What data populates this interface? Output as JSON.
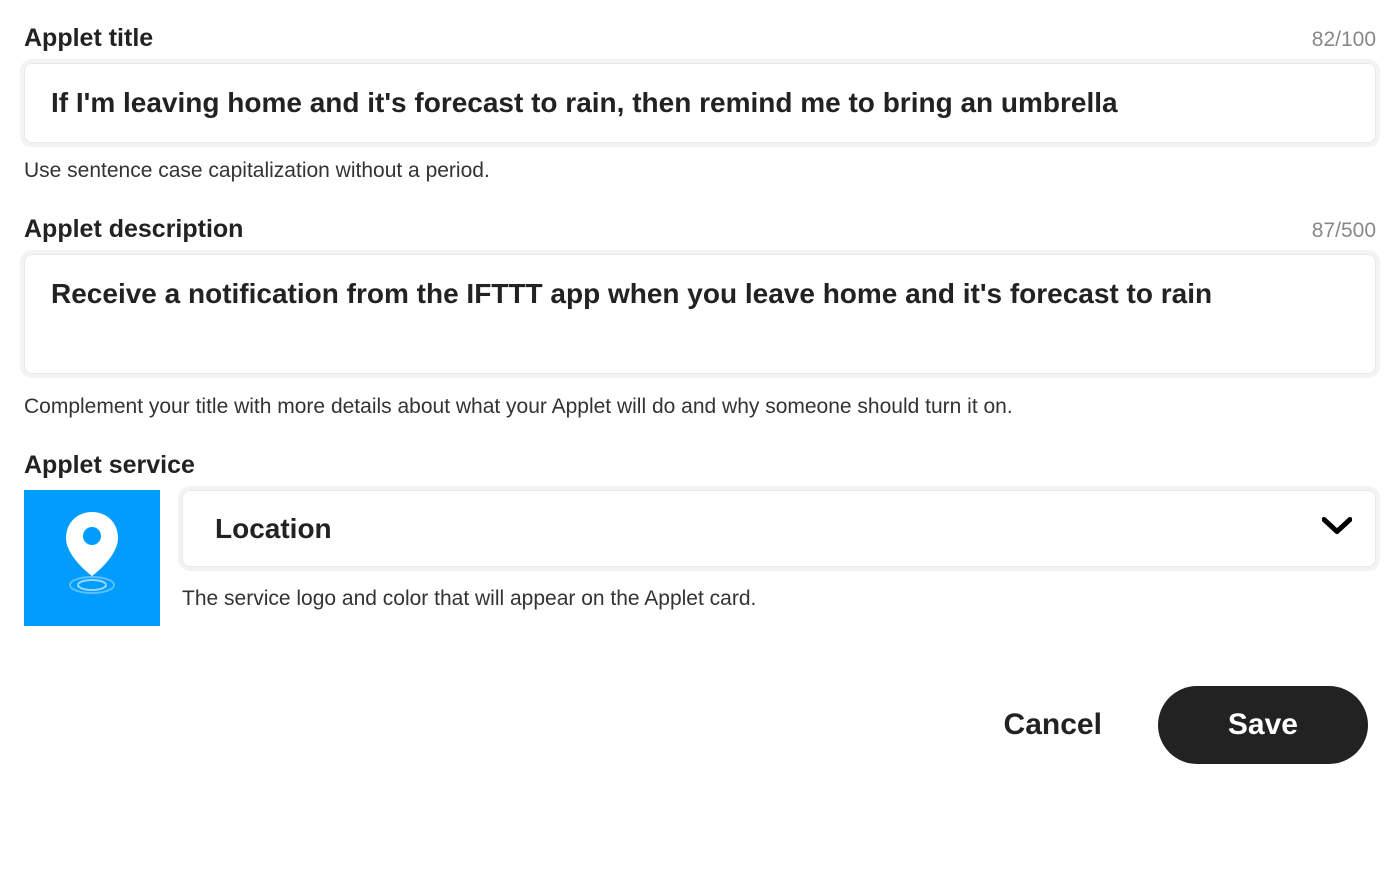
{
  "title_section": {
    "label": "Applet title",
    "counter": "82/100",
    "value": "If I'm leaving home and it's forecast to rain, then remind me to bring an umbrella",
    "hint": "Use sentence case capitalization without a period."
  },
  "description_section": {
    "label": "Applet description",
    "counter": "87/500",
    "value": "Receive a notification from the IFTTT app when you leave home and it's forecast to rain",
    "hint": "Complement your title with more details about what your Applet will do and why someone should turn it on."
  },
  "service_section": {
    "label": "Applet service",
    "selected": "Location",
    "hint": "The service logo and color that will appear on the Applet card.",
    "logo_color": "#009dff"
  },
  "buttons": {
    "cancel": "Cancel",
    "save": "Save"
  }
}
